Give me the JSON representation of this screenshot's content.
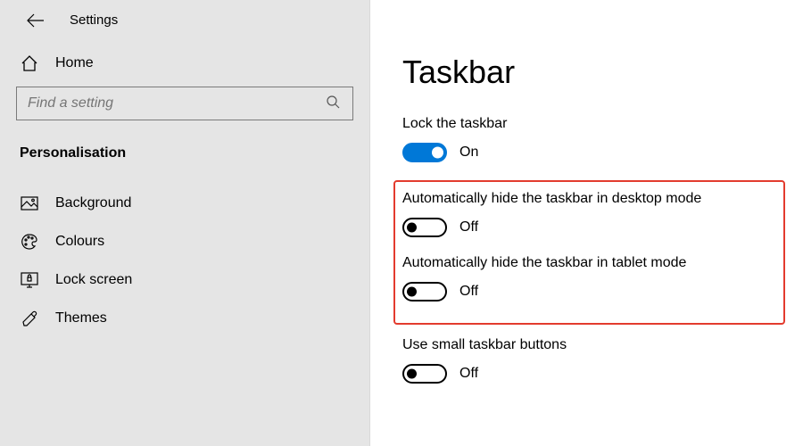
{
  "header": {
    "title": "Settings"
  },
  "search": {
    "placeholder": "Find a setting"
  },
  "sidebar": {
    "home": "Home",
    "category": "Personalisation",
    "items": [
      {
        "label": "Background"
      },
      {
        "label": "Colours"
      },
      {
        "label": "Lock screen"
      },
      {
        "label": "Themes"
      }
    ]
  },
  "page": {
    "title": "Taskbar",
    "options": [
      {
        "label": "Lock the taskbar",
        "state": "On"
      },
      {
        "label": "Automatically hide the taskbar in desktop mode",
        "state": "Off"
      },
      {
        "label": "Automatically hide the taskbar in tablet mode",
        "state": "Off"
      },
      {
        "label": "Use small taskbar buttons",
        "state": "Off"
      }
    ]
  }
}
